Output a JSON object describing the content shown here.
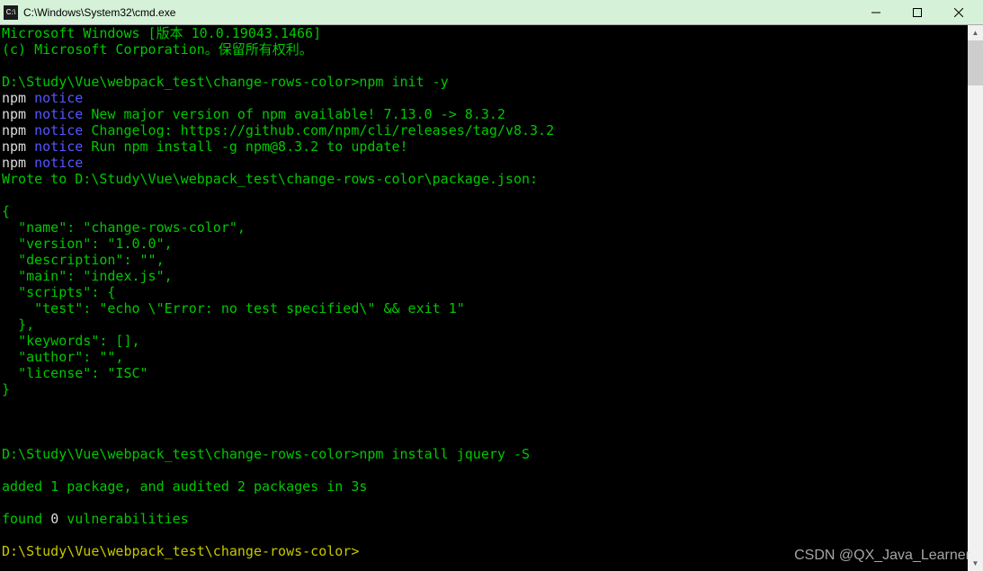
{
  "titlebar": {
    "icon_label": "C:\\",
    "title": "C:\\Windows\\System32\\cmd.exe"
  },
  "terminal": {
    "header1": "Microsoft Windows [版本 10.0.19043.1466]",
    "header2": "(c) Microsoft Corporation。保留所有权利。",
    "prompt1_path": "D:\\Study\\Vue\\webpack_test\\change-rows-color>",
    "prompt1_cmd": "npm init -y",
    "notice_prefix": "npm",
    "notice_word": "notice",
    "notice_line1": "",
    "notice_line2": "New major version of npm available! 7.13.0 -> 8.3.2",
    "notice_line3": "Changelog: https://github.com/npm/cli/releases/tag/v8.3.2",
    "notice_line4": "Run npm install -g npm@8.3.2 to update!",
    "notice_line5": "",
    "wrote_line": "Wrote to D:\\Study\\Vue\\webpack_test\\change-rows-color\\package.json:",
    "json_block": "{\n  \"name\": \"change-rows-color\",\n  \"version\": \"1.0.0\",\n  \"description\": \"\",\n  \"main\": \"index.js\",\n  \"scripts\": {\n    \"test\": \"echo \\\"Error: no test specified\\\" && exit 1\"\n  },\n  \"keywords\": [],\n  \"author\": \"\",\n  \"license\": \"ISC\"\n}",
    "prompt2_path": "D:\\Study\\Vue\\webpack_test\\change-rows-color>",
    "prompt2_cmd": "npm install jquery -S",
    "result_line1": "added 1 package, and audited 2 packages in 3s",
    "result_line2_a": "found ",
    "result_line2_b": "0",
    "result_line2_c": " vulnerabilities",
    "prompt3_path": "D:\\Study\\Vue\\webpack_test\\change-rows-color>"
  },
  "watermark": "CSDN @QX_Java_Learner"
}
